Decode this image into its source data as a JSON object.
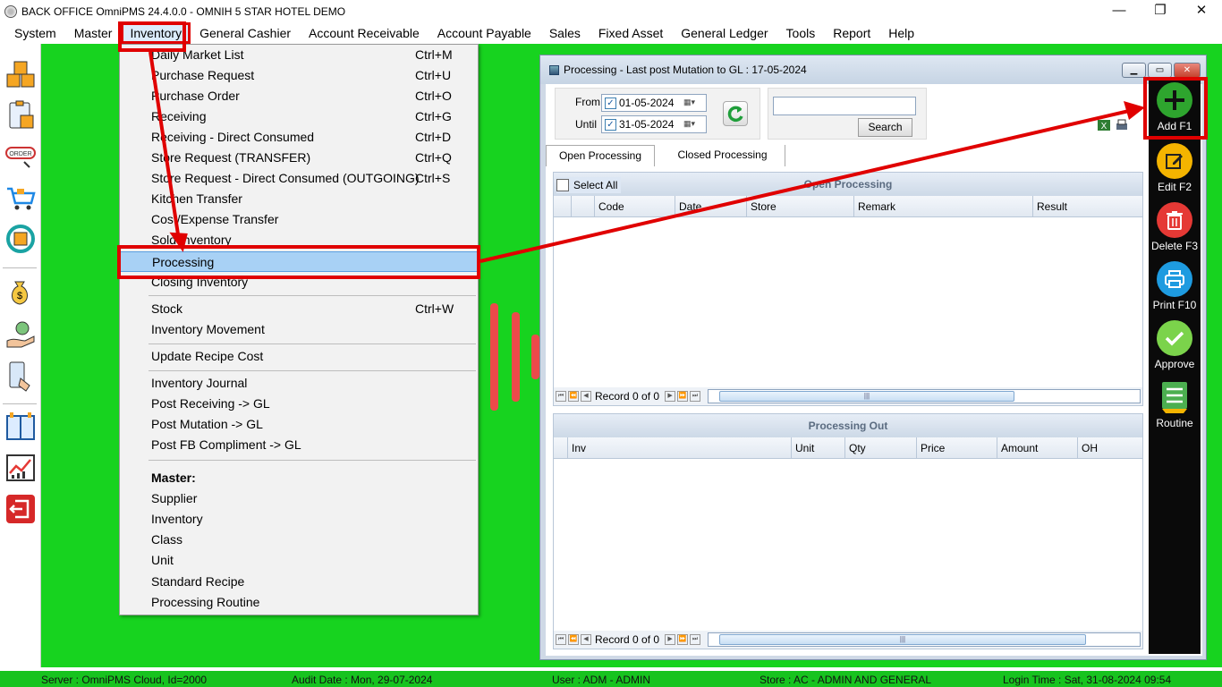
{
  "titlebar": {
    "title": "BACK OFFICE OmniPMS 24.4.0.0 - OMNIH 5 STAR HOTEL DEMO",
    "min": "—",
    "max": "❐",
    "close": "✕"
  },
  "menubar": [
    "System",
    "Master",
    "Inventory",
    "General Cashier",
    "Account Receivable",
    "Account Payable",
    "Sales",
    "Fixed Asset",
    "General Ledger",
    "Tools",
    "Report",
    "Help"
  ],
  "dropdown": {
    "items": [
      {
        "label": "Daily Market List",
        "shortcut": "Ctrl+M"
      },
      {
        "label": "Purchase Request",
        "shortcut": "Ctrl+U"
      },
      {
        "label": "Purchase Order",
        "shortcut": "Ctrl+O"
      },
      {
        "label": "Receiving",
        "shortcut": "Ctrl+G"
      },
      {
        "label": "Receiving - Direct Consumed",
        "shortcut": "Ctrl+D"
      },
      {
        "label": "Store Request (TRANSFER)",
        "shortcut": "Ctrl+Q"
      },
      {
        "label": "Store Request - Direct Consumed (OUTGOING)",
        "shortcut": "Ctrl+S"
      },
      {
        "label": "Kitchen Transfer",
        "shortcut": ""
      },
      {
        "label": "Cost/Expense Transfer",
        "shortcut": ""
      },
      {
        "label": "Sold Inventory",
        "shortcut": ""
      },
      {
        "label": "Processing",
        "shortcut": ""
      },
      {
        "label": "Closing Inventory",
        "shortcut": ""
      },
      {
        "label": "Stock",
        "shortcut": "Ctrl+W"
      },
      {
        "label": "Inventory Movement",
        "shortcut": ""
      },
      {
        "label": "Update Recipe Cost",
        "shortcut": ""
      },
      {
        "label": "Inventory Journal",
        "shortcut": ""
      },
      {
        "label": "Post Receiving -> GL",
        "shortcut": ""
      },
      {
        "label": "Post Mutation -> GL",
        "shortcut": ""
      },
      {
        "label": "Post FB Compliment -> GL",
        "shortcut": ""
      },
      {
        "label": "Master:",
        "shortcut": ""
      },
      {
        "label": "Supplier",
        "shortcut": ""
      },
      {
        "label": "Inventory",
        "shortcut": ""
      },
      {
        "label": "Class",
        "shortcut": ""
      },
      {
        "label": "Unit",
        "shortcut": ""
      },
      {
        "label": "Standard Recipe",
        "shortcut": ""
      },
      {
        "label": "Processing Routine",
        "shortcut": ""
      }
    ]
  },
  "window": {
    "title": "Processing - Last post Mutation to GL : 17-05-2024",
    "from_label": "From",
    "until_label": "Until",
    "from_date": "01-05-2024",
    "until_date": "31-05-2024",
    "search_value": "",
    "search_button": "Search",
    "tabs": [
      "Open Processing",
      "Closed Processing"
    ],
    "grid1": {
      "select_all": "Select All",
      "band": "Open Processing",
      "columns": [
        "Code",
        "Date",
        "Store",
        "Remark",
        "Result"
      ],
      "record": "Record 0 of 0"
    },
    "grid2": {
      "band": "Processing Out",
      "columns": [
        "Inv",
        "Unit",
        "Qty",
        "Price",
        "Amount",
        "OH"
      ],
      "record": "Record 0 of 0"
    }
  },
  "right_toolbar": [
    {
      "label": "Add F1",
      "icon": "plus-icon",
      "color": "#2ea52e"
    },
    {
      "label": "Edit F2",
      "icon": "edit-icon",
      "color": "#f4b400"
    },
    {
      "label": "Delete F3",
      "icon": "trash-icon",
      "color": "#e53935"
    },
    {
      "label": "Print F10",
      "icon": "printer-icon",
      "color": "#1e9be0"
    },
    {
      "label": "Approve",
      "icon": "check-icon",
      "color": "#7bd34b"
    },
    {
      "label": "Routine",
      "icon": "list-icon",
      "color": "#4caf50"
    }
  ],
  "statusbar": {
    "server": "Server : OmniPMS Cloud, Id=2000",
    "audit": "Audit Date : Mon, 29-07-2024",
    "user": "User : ADM - ADMIN",
    "store": "Store : AC - ADMIN AND GENERAL",
    "login": "Login Time : Sat, 31-08-2024 09:54"
  },
  "colors": {
    "workspace": "#17d31f",
    "annotation": "#e00000",
    "highlight": "#a8d1f5"
  }
}
